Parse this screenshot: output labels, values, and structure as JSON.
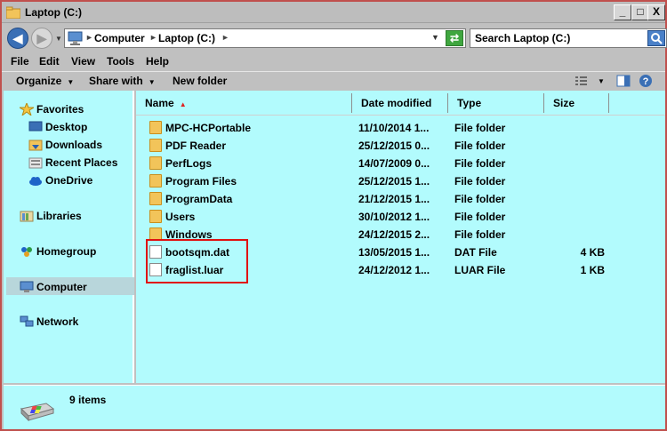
{
  "window": {
    "title": "Laptop (C:)"
  },
  "controls": {
    "minimize": "_",
    "maximize": "□",
    "close": "X"
  },
  "address": {
    "crumbs": [
      "Computer",
      "Laptop (C:)"
    ],
    "search_placeholder": "Search Laptop (C:)"
  },
  "menu": {
    "items": [
      {
        "label": "File"
      },
      {
        "label": "Edit"
      },
      {
        "label": "View"
      },
      {
        "label": "Tools"
      },
      {
        "label": "Help"
      }
    ]
  },
  "commands": {
    "organize": "Organize",
    "share_with": "Share with",
    "new_folder": "New folder"
  },
  "nav": {
    "favorites": "Favorites",
    "desktop": "Desktop",
    "downloads": "Downloads",
    "recent_places": "Recent Places",
    "onedrive": "OneDrive",
    "libraries": "Libraries",
    "homegroup": "Homegroup",
    "computer": "Computer",
    "network": "Network"
  },
  "columns": {
    "name": "Name",
    "date": "Date modified",
    "type": "Type",
    "size": "Size"
  },
  "files": [
    {
      "name": "MPC-HCPortable",
      "date": "11/10/2014 1...",
      "type": "File folder",
      "size": "",
      "kind": "folder"
    },
    {
      "name": "PDF Reader",
      "date": "25/12/2015 0...",
      "type": "File folder",
      "size": "",
      "kind": "folder"
    },
    {
      "name": "PerfLogs",
      "date": "14/07/2009 0...",
      "type": "File folder",
      "size": "",
      "kind": "folder"
    },
    {
      "name": "Program Files",
      "date": "25/12/2015 1...",
      "type": "File folder",
      "size": "",
      "kind": "folder"
    },
    {
      "name": "ProgramData",
      "date": "21/12/2015 1...",
      "type": "File folder",
      "size": "",
      "kind": "folder"
    },
    {
      "name": "Users",
      "date": "30/10/2012 1...",
      "type": "File folder",
      "size": "",
      "kind": "folder"
    },
    {
      "name": "Windows",
      "date": "24/12/2015 2...",
      "type": "File folder",
      "size": "",
      "kind": "folder"
    },
    {
      "name": "bootsqm.dat",
      "date": "13/05/2015 1...",
      "type": "DAT File",
      "size": "4 KB",
      "kind": "file"
    },
    {
      "name": "fraglist.luar",
      "date": "24/12/2012 1...",
      "type": "LUAR File",
      "size": "1 KB",
      "kind": "file"
    }
  ],
  "status": {
    "count": "9 items"
  },
  "colors": {
    "pane_bg": "#b2fbfd",
    "chrome": "#c0c0c0",
    "highlight": "#e01010"
  }
}
